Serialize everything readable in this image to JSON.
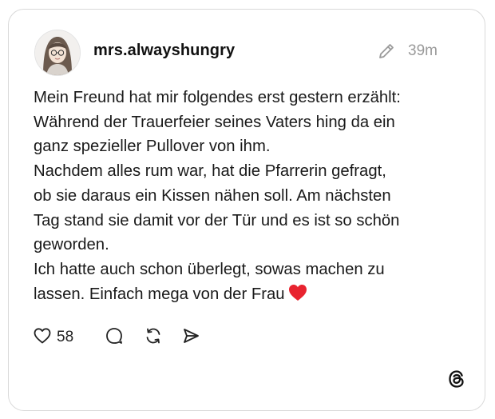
{
  "post": {
    "username": "mrs.alwayshungry",
    "time": "39m",
    "lines": [
      "Mein Freund hat mir folgendes erst gestern erzählt:",
      "Während der Trauerfeier seines Vaters hing da ein",
      "ganz spezieller Pullover von ihm.",
      "Nachdem alles rum war, hat die Pfarrerin gefragt,",
      "ob sie daraus ein Kissen nähen soll. Am nächsten",
      "Tag stand sie damit vor der Tür und es ist so schön",
      "geworden.",
      "Ich hatte auch schon überlegt, sowas machen zu",
      "lassen. Einfach mega von der Frau"
    ],
    "emoji": "red-heart",
    "like_count": "58"
  },
  "icons": {
    "edit": "pencil-icon",
    "like": "heart-icon",
    "comment": "comment-icon",
    "repost": "repost-icon",
    "share": "send-icon",
    "brand": "threads-logo-icon"
  },
  "colors": {
    "heart_emoji": "#e8232f",
    "muted_text": "#9a9a9a",
    "border": "#d9d9d9"
  }
}
